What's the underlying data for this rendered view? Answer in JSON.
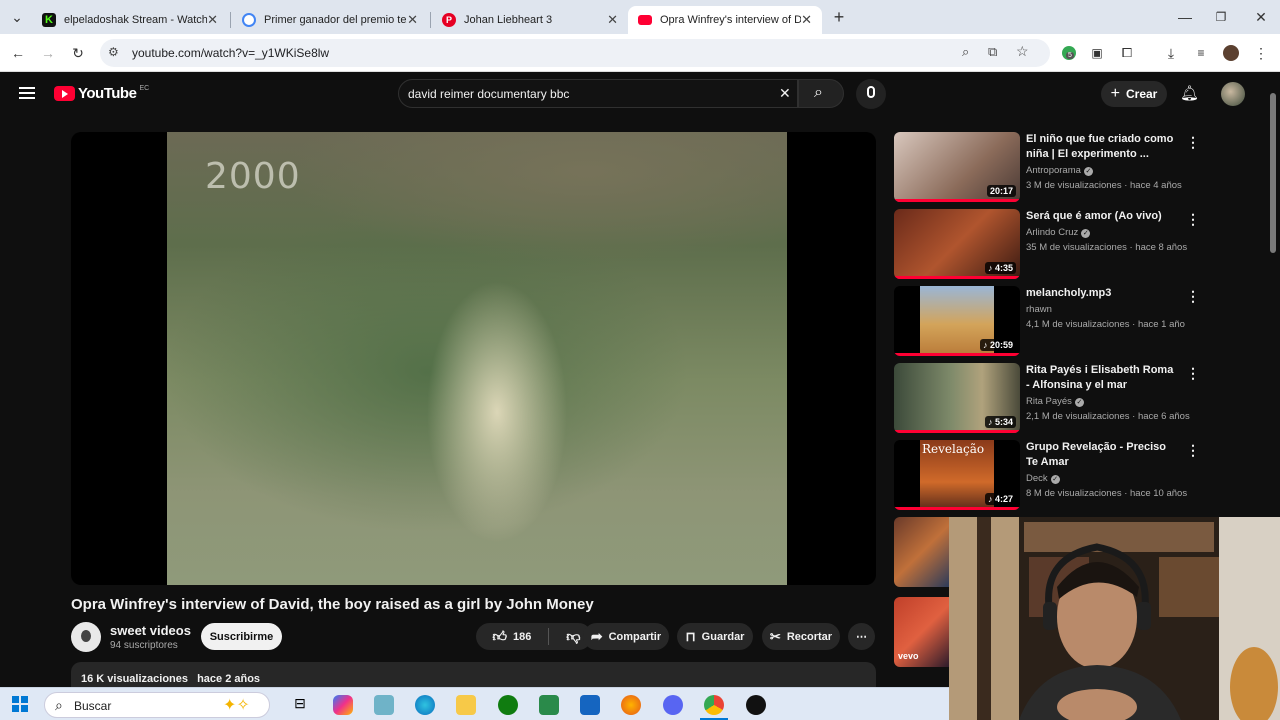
{
  "browser": {
    "tabs": [
      {
        "title": "elpeladoshak Stream - Watch Live",
        "favicon_color": "#53fc18"
      },
      {
        "title": "Primer ganador del premio tezu",
        "favicon_color": "#4285f4"
      },
      {
        "title": "Johan Liebheart 3",
        "favicon_color": "#e60023"
      },
      {
        "title": "Opra Winfrey's interview of Dav",
        "favicon_color": "#ff0033"
      }
    ],
    "url": "youtube.com/watch?v=_y1WKiSe8lw",
    "extension_badge": "5"
  },
  "youtube": {
    "logo": "YouTube",
    "region": "EC",
    "search_value": "david reimer documentary bbc",
    "create_label": "Crear"
  },
  "video": {
    "overlay_year": "2000",
    "title": "Opra Winfrey's interview of David, the boy raised as a girl by John Money",
    "channel": "sweet videos",
    "subscribers": "94 suscriptores",
    "subscribe_label": "Suscribirme",
    "likes": "186",
    "share_label": "Compartir",
    "save_label": "Guardar",
    "clip_label": "Recortar",
    "views": "16 K visualizaciones",
    "date": "hace 2 años"
  },
  "recommendations": [
    {
      "title": "El niño que fue criado como niña | El experimento ...",
      "channel": "Antroporama",
      "verified": true,
      "meta": "3 M de visualizaciones · hace 4 años",
      "duration": "20:17",
      "music": false,
      "thumb_color": "#c9b9b0"
    },
    {
      "title": "Será que é amor (Ao vivo)",
      "channel": "Arlindo Cruz",
      "verified": true,
      "meta": "35 M de visualizaciones · hace 8 años",
      "duration": "4:35",
      "music": true,
      "thumb_color": "#8a3a22"
    },
    {
      "title": "melancholy.mp3",
      "channel": "rhawn",
      "verified": false,
      "meta": "4,1 M de visualizaciones · hace 1 año",
      "duration": "20:59",
      "music": true,
      "thumb_color": "#c79a52"
    },
    {
      "title": "Rita Payés i Elisabeth Roma - Alfonsina y el mar",
      "channel": "Rita Payés",
      "verified": true,
      "meta": "2,1 M de visualizaciones · hace 6 años",
      "duration": "5:34",
      "music": true,
      "thumb_color": "#5a6a4a"
    },
    {
      "title": "Grupo Revelação - Preciso Te Amar",
      "channel": "Deck",
      "verified": true,
      "meta": "8 M de visualizaciones · hace 10 años",
      "duration": "4:27",
      "music": true,
      "thumb_color": "#b4562c",
      "thumb_text": "Revelação"
    }
  ],
  "partial_thumb_label": "vevo",
  "taskbar": {
    "search_placeholder": "Buscar"
  }
}
